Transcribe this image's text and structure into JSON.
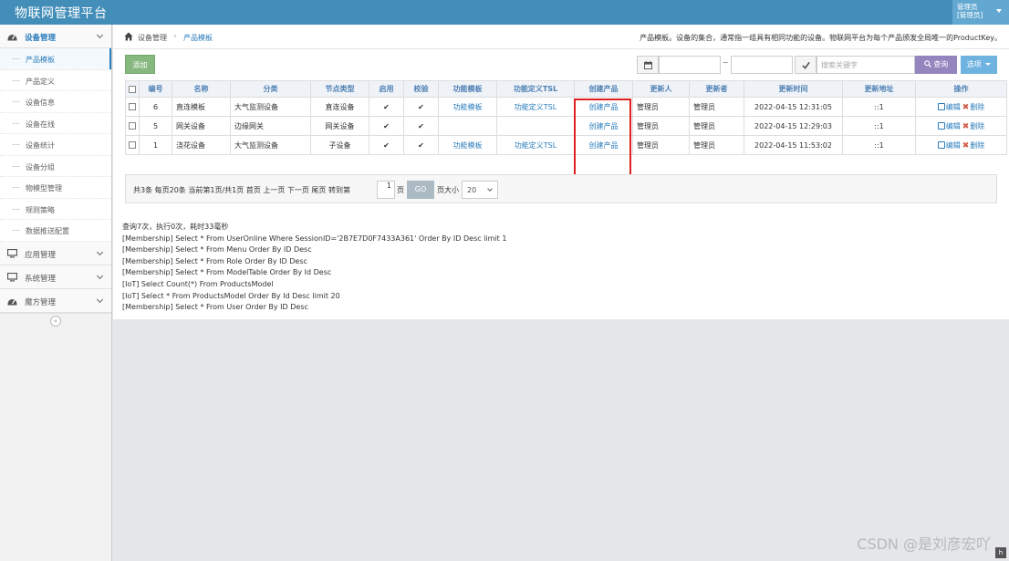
{
  "app": {
    "title": "物联网管理平台"
  },
  "user": {
    "name": "管理员",
    "role": "[管理员]"
  },
  "sidebar": {
    "groups": [
      {
        "label": "设备管理",
        "icon": "dashboard-icon"
      },
      {
        "label": "应用管理",
        "icon": "desktop-icon"
      },
      {
        "label": "系统管理",
        "icon": "desktop-icon"
      },
      {
        "label": "魔方管理",
        "icon": "dashboard-icon"
      }
    ],
    "items": [
      "产品模板",
      "产品定义",
      "设备信息",
      "设备在线",
      "设备统计",
      "设备分组",
      "物模型管理",
      "规则策略",
      "数据推送配置"
    ],
    "collapse": "«"
  },
  "breadcrumb": {
    "items": [
      "设备管理",
      "产品模板"
    ],
    "separator": "›",
    "description": "产品模板。设备的集合，通常指一组具有相同功能的设备。物联网平台为每个产品颁发全局唯一的ProductKey。"
  },
  "toolbar": {
    "add_label": "添加",
    "tilde": "~",
    "search_placeholder": "搜索关键字",
    "query_label": "查询",
    "more_label": "选项"
  },
  "table": {
    "headers": [
      "编号",
      "名称",
      "分类",
      "节点类型",
      "启用",
      "校验",
      "功能模板",
      "功能定义TSL",
      "创建产品",
      "更新人",
      "更新者",
      "更新时间",
      "更新地址",
      "操作"
    ],
    "rows": [
      {
        "id": "6",
        "name": "直连模板",
        "category": "大气监测设备",
        "node_type": "直连设备",
        "enabled": "✔",
        "verified": "✔",
        "func_template": "功能模板",
        "tsl": "功能定义TSL",
        "create": "创建产品",
        "updater": "管理员",
        "updated_by": "管理员",
        "time": "2022-04-15 12:31:05",
        "addr": "::1"
      },
      {
        "id": "5",
        "name": "网关设备",
        "category": "边缘网关",
        "node_type": "网关设备",
        "enabled": "✔",
        "verified": "✔",
        "func_template": "",
        "tsl": "",
        "create": "创建产品",
        "updater": "管理员",
        "updated_by": "管理员",
        "time": "2022-04-15 12:29:03",
        "addr": "::1"
      },
      {
        "id": "1",
        "name": "浇花设备",
        "category": "大气监测设备",
        "node_type": "子设备",
        "enabled": "✔",
        "verified": "✔",
        "func_template": "功能模板",
        "tsl": "功能定义TSL",
        "create": "创建产品",
        "updater": "管理员",
        "updated_by": "管理员",
        "time": "2022-04-15 11:53:02",
        "addr": "::1"
      }
    ],
    "edit_label": "编辑",
    "delete_label": "删除",
    "delete_mark": "✖"
  },
  "pager": {
    "summary": "共3条  每页20条  当前第1页/共1页  首页  上一页  下一页  尾页  转到第",
    "page_value": "1",
    "page_unit": "页",
    "go_label": "GO",
    "size_label": "页大小",
    "size_value": "20"
  },
  "log": [
    "查询7次，执行0次，耗时33毫秒",
    "[Membership] Select * From UserOnline Where SessionID='2B7E7D0F7433A361' Order By ID Desc limit 1",
    "[Membership] Select * From Menu Order By ID Desc",
    "[Membership] Select * From Role Order By ID Desc",
    "[Membership] Select * From ModelTable Order By Id Desc",
    "[IoT] Select Count(*) From ProductsModel",
    "[IoT] Select * From ProductsModel Order By Id Desc limit 20",
    "[Membership] Select * From User Order By ID Desc"
  ],
  "watermark": "CSDN @是刘彦宏吖",
  "corner_glyph": "h",
  "colors": {
    "header": "#438eb9",
    "link": "#2b7dbc",
    "add": "#87b87f",
    "query": "#9585bf",
    "highlight": "#e02020"
  }
}
